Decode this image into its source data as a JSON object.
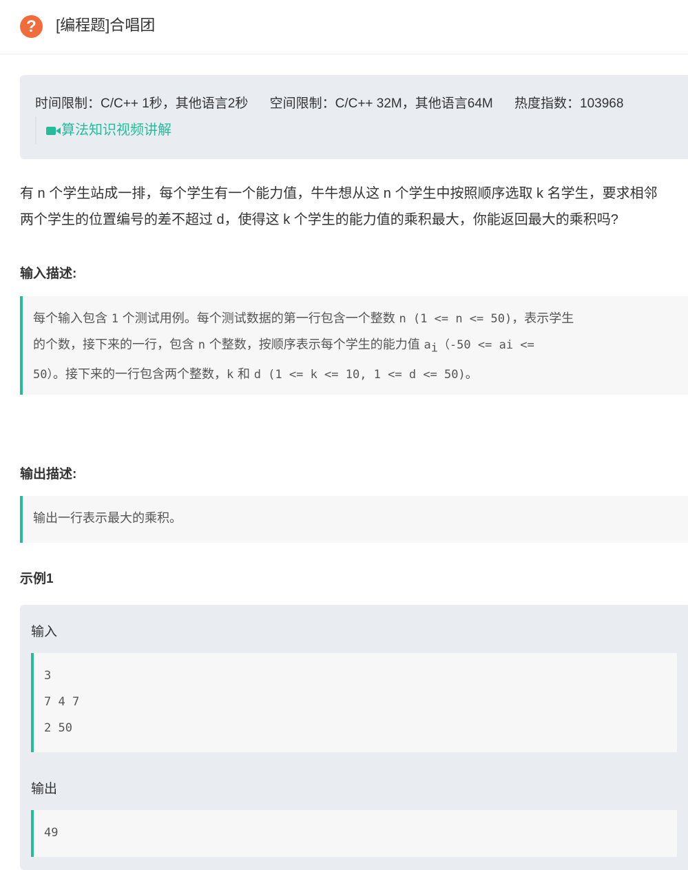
{
  "header": {
    "icon": "help-circle-icon",
    "title": "[编程题]合唱团"
  },
  "limits": {
    "time": "时间限制：C/C++ 1秒，其他语言2秒",
    "space": "空间限制：C/C++ 32M，其他语言64M",
    "heat": "热度指数：103968",
    "video_link": "算法知识视频讲解",
    "video_icon": "video-camera-icon"
  },
  "description": {
    "line1": "有 n 个学生站成一排，每个学生有一个能力值，牛牛想从这 n 个学生中按照顺序选取 k 名学生，要求相邻",
    "line2": "两个学生的位置编号的差不超过 d，使得这 k 个学生的能力值的乘积最大，你能返回最大的乘积吗?"
  },
  "input_section": {
    "heading": "输入描述:",
    "p1": "每个输入包含 ",
    "p2": "1",
    "p3": " 个测试用例。每个测试数据的第一行包含一个整数 ",
    "p4": "n (1 <= n <= 50)",
    "p5": "，表示学生",
    "p6": "的个数，接下来的一行，包含 ",
    "p7": "n",
    "p8": " 个整数，按顺序表示每个学生的能力值 ",
    "p9": "a",
    "p10": "i",
    "p11": "（-50 <= ai <=",
    "p12": "50）",
    "p13": "。接下来的一行包含两个整数，",
    "p14": "k",
    "p15": " 和 ",
    "p16": "d (1 <= k <= 10, 1 <= d <= 50)",
    "p17": "。"
  },
  "output_section": {
    "heading": "输出描述:",
    "text": "输出一行表示最大的乘积。"
  },
  "example": {
    "heading": "示例1",
    "input_label": "输入",
    "input_lines": [
      "3",
      "7 4 7",
      "2 50"
    ],
    "output_label": "输出",
    "output_lines": [
      "49"
    ]
  }
}
